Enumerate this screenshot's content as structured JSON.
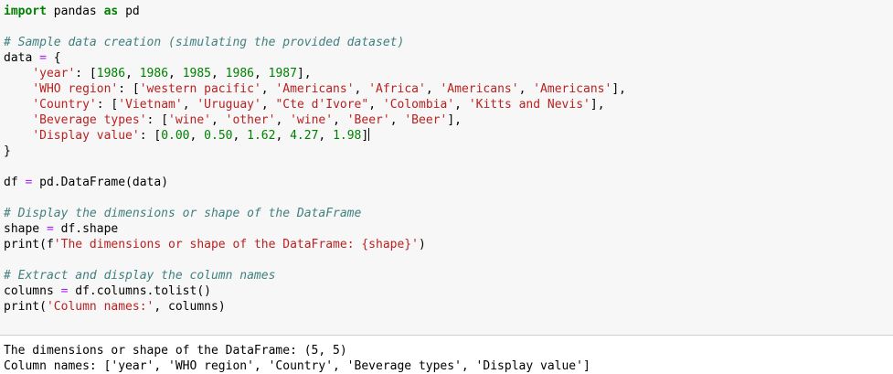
{
  "code": {
    "l1": {
      "kw1": "import",
      "t1": " pandas ",
      "kw2": "as",
      "t2": " pd"
    },
    "l3": "# Sample data creation (simulating the provided dataset)",
    "l4": {
      "a": "data ",
      "b": "=",
      "c": " {"
    },
    "l5": {
      "pad": "    ",
      "key": "'year'",
      "c": ": [",
      "n1": "1986",
      "s1": ", ",
      "n2": "1986",
      "s2": ", ",
      "n3": "1985",
      "s3": ", ",
      "n4": "1986",
      "s4": ", ",
      "n5": "1987",
      "end": "],"
    },
    "l6": {
      "pad": "    ",
      "key": "'WHO region'",
      "c": ": [",
      "v1": "'western pacific'",
      "s1": ", ",
      "v2": "'Americans'",
      "s2": ", ",
      "v3": "'Africa'",
      "s3": ", ",
      "v4": "'Americans'",
      "s4": ", ",
      "v5": "'Americans'",
      "end": "],"
    },
    "l7": {
      "pad": "    ",
      "key": "'Country'",
      "c": ": [",
      "v1": "'Vietnam'",
      "s1": ", ",
      "v2": "'Uruguay'",
      "s2": ", ",
      "v3": "\"Cte d'Ivore\"",
      "s3": ", ",
      "v4": "'Colombia'",
      "s4": ", ",
      "v5": "'Kitts and Nevis'",
      "end": "],"
    },
    "l8": {
      "pad": "    ",
      "key": "'Beverage types'",
      "c": ": [",
      "v1": "'wine'",
      "s1": ", ",
      "v2": "'other'",
      "s2": ", ",
      "v3": "'wine'",
      "s3": ", ",
      "v4": "'Beer'",
      "s4": ", ",
      "v5": "'Beer'",
      "end": "],"
    },
    "l9": {
      "pad": "    ",
      "key": "'Display value'",
      "c": ": [",
      "n1": "0.00",
      "s1": ", ",
      "n2": "0.50",
      "s2": ", ",
      "n3": "1.62",
      "s3": ", ",
      "n4": "4.27",
      "s4": ", ",
      "n5": "1.98",
      "end": "]"
    },
    "l10": "}",
    "l12": {
      "a": "df ",
      "b": "=",
      "c": " pd.DataFrame(data)"
    },
    "l14": "# Display the dimensions or shape of the DataFrame",
    "l15": {
      "a": "shape ",
      "b": "=",
      "c": " df.shape"
    },
    "l16": {
      "a": "print(f",
      "s": "'The dimensions or shape of the DataFrame: {shape}'",
      "c": ")"
    },
    "l18": "# Extract and display the column names",
    "l19": {
      "a": "columns ",
      "b": "=",
      "c": " df.columns.tolist()"
    },
    "l20": {
      "a": "print(",
      "s": "'Column names:'",
      "c": ", columns)"
    }
  },
  "output": {
    "line1": "The dimensions or shape of the DataFrame: (5, 5)",
    "line2": "Column names: ['year', 'WHO region', 'Country', 'Beverage types', 'Display value']"
  }
}
